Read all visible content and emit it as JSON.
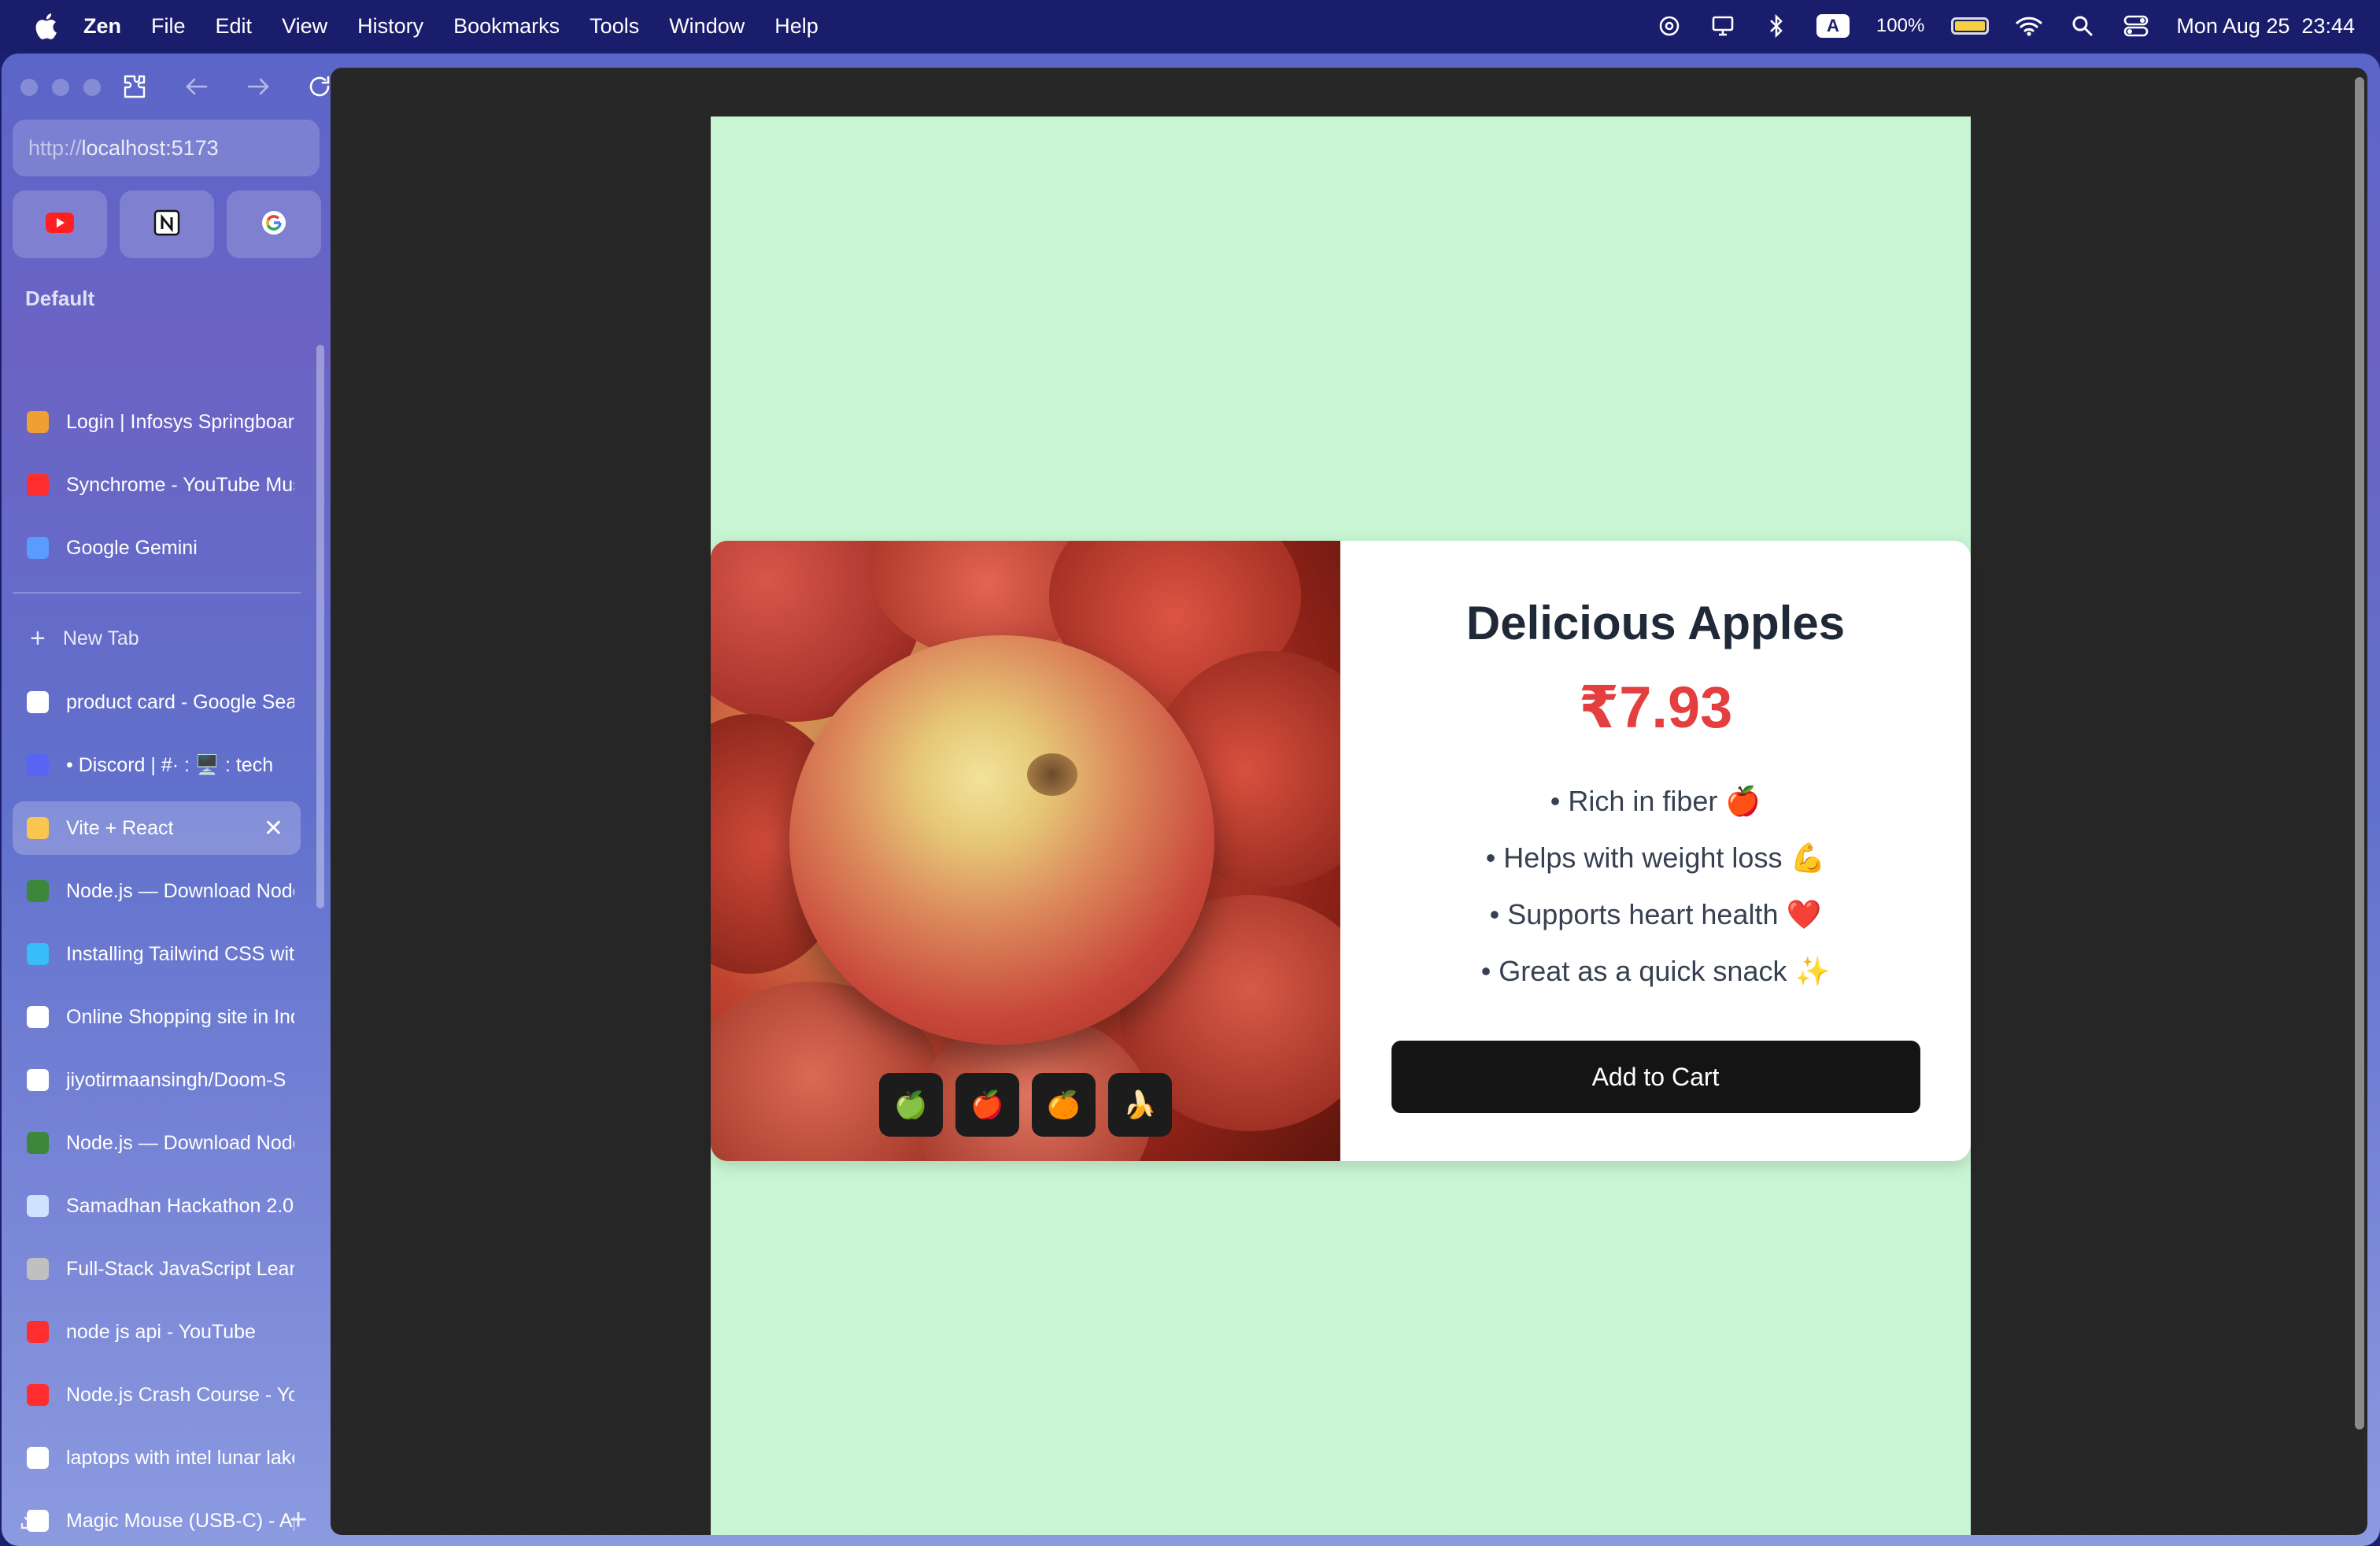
{
  "menubar": {
    "app_name": "Zen",
    "menus": [
      "File",
      "Edit",
      "View",
      "History",
      "Bookmarks",
      "Tools",
      "Window",
      "Help"
    ],
    "battery_percent": "100%",
    "battery_level": 1.0,
    "input_badge": "A",
    "clock": "Mon Aug 25  23:44"
  },
  "browser": {
    "url": {
      "scheme": "http://",
      "host": "localhost:5173"
    },
    "pinned": [
      "youtube-icon",
      "notion-icon",
      "google-icon"
    ],
    "space_label": "Default",
    "essential_tabs": [
      {
        "label": "Login | Infosys Springboard",
        "icon": "infosys-icon",
        "color": "#f0a030"
      },
      {
        "label": "Synchrome - YouTube Music",
        "icon": "youtube-music-icon",
        "color": "#ff2d2d"
      },
      {
        "label": "Google Gemini",
        "icon": "gemini-icon",
        "color": "#5b9bff"
      }
    ],
    "new_tab_label": "New Tab",
    "tabs": [
      {
        "label": "product card - Google Search",
        "icon": "google-icon",
        "color": "#ffffff"
      },
      {
        "label": "• Discord | #· : 🖥️ : tech",
        "icon": "discord-icon",
        "color": "#5865f2"
      },
      {
        "label": "Vite + React",
        "icon": "vite-icon",
        "color": "#f9c74f",
        "active": true
      },
      {
        "label": "Node.js — Download Node.js",
        "icon": "nodejs-icon",
        "color": "#3c873a"
      },
      {
        "label": "Installing Tailwind CSS with Vite",
        "icon": "tailwind-icon",
        "color": "#38bdf8"
      },
      {
        "label": "Online Shopping site in India",
        "icon": "amazon-icon",
        "color": "#ffffff"
      },
      {
        "label": "jiyotirmaansingh/Doom-S",
        "icon": "github-icon",
        "color": "#ffffff"
      },
      {
        "label": "Node.js — Download Node.js",
        "icon": "nodejs-icon",
        "color": "#3c873a"
      },
      {
        "label": "Samadhan Hackathon 2.0",
        "icon": "samadhan-icon",
        "color": "#cfe3ff"
      },
      {
        "label": "Full-Stack JavaScript Learning",
        "icon": "javascript-icon",
        "color": "#c0c0c0"
      },
      {
        "label": "node js api - YouTube",
        "icon": "youtube-icon",
        "color": "#ff2d2d"
      },
      {
        "label": "Node.js Crash Course - YouTube",
        "icon": "youtube-icon",
        "color": "#ff2d2d"
      },
      {
        "label": "laptops with intel lunar lake",
        "icon": "google-icon",
        "color": "#ffffff"
      },
      {
        "label": "Magic Mouse (USB-C) - Apple",
        "icon": "apple-icon",
        "color": "#ffffff"
      }
    ]
  },
  "product": {
    "title": "Delicious Apples",
    "price": "₹7.93",
    "features": [
      "• Rich in fiber 🍎",
      "• Helps with weight loss 💪",
      "• Supports heart health ❤️",
      "• Great as a quick snack ✨"
    ],
    "cart_label": "Add to Cart",
    "thumbnails": [
      {
        "emoji": "🍏",
        "name": "green-apple-thumb"
      },
      {
        "emoji": "🍎",
        "name": "red-apple-thumb"
      },
      {
        "emoji": "🍊",
        "name": "orange-thumb"
      },
      {
        "emoji": "🍌",
        "name": "banana-thumb"
      }
    ],
    "image_alt": "Red apples with water droplets"
  },
  "colors": {
    "page_background": "#c8f5d3",
    "price": "#e53e3e",
    "button": "#141414",
    "sidebar_accent": "#6170cc"
  }
}
